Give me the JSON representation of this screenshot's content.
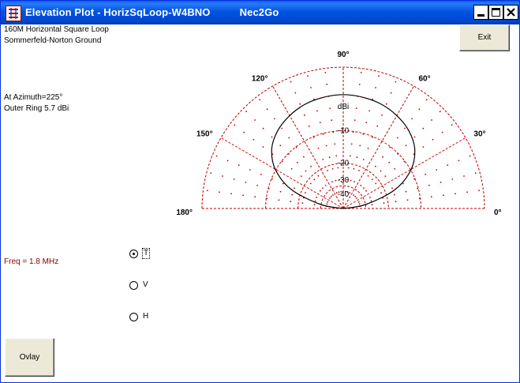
{
  "window": {
    "title": "Elevation Plot - HorizSqLoop-W4BNO          Nec2Go"
  },
  "info": {
    "line1": "160M Horizontal Square Loop",
    "line2": "Sommerfeld-Norton Ground",
    "azimuth": "At Azimuth=225°",
    "outer_ring": "Outer Ring 5.7 dBi",
    "freq": "Freq = 1.8 MHz"
  },
  "buttons": {
    "exit": "Exit",
    "ovlay": "Ovlay"
  },
  "radios": [
    {
      "label": "T",
      "selected": true
    },
    {
      "label": "V",
      "selected": false
    },
    {
      "label": "H",
      "selected": false
    }
  ],
  "colors": {
    "grid": "#c00000",
    "pattern": "#000000",
    "freq": "#800000",
    "titlebar": "#0054e3"
  },
  "chart_data": {
    "type": "polar",
    "angle_labels": [
      "0°",
      "30°",
      "60°",
      "90°",
      "120°",
      "150°",
      "180°"
    ],
    "ring_labels": [
      "dBi",
      "-10",
      "-20",
      "-30",
      "-40"
    ],
    "outer_ring_dbi": 5.7,
    "series": [
      {
        "elevation_deg": [
          0,
          10,
          20,
          30,
          40,
          50,
          60,
          70,
          80,
          90,
          100,
          110,
          120,
          130,
          140,
          150,
          160,
          170,
          180
        ],
        "gain_dbi": [
          -99,
          -15.5,
          -5.2,
          -1.1,
          0.9,
          1.9,
          2.5,
          2.9,
          3.1,
          3.2,
          3.1,
          2.9,
          2.5,
          1.9,
          0.9,
          -1.1,
          -5.2,
          -15.5,
          -99
        ]
      }
    ]
  }
}
